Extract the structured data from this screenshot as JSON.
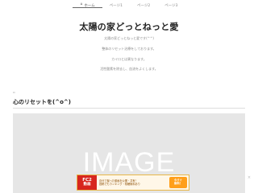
{
  "nav": {
    "items": [
      {
        "label": "ホーム",
        "icon": "home-icon",
        "active": true
      },
      {
        "label": "ページ1",
        "icon": "",
        "active": false
      },
      {
        "label": "ページ2",
        "icon": "",
        "active": false
      },
      {
        "label": "ページ3",
        "icon": "",
        "active": false
      }
    ]
  },
  "header": {
    "title": "太陽の家どっとねっと愛",
    "taglines": [
      "太陽の家どっとねっと愛です(^^)",
      "整体のリセット治療をしております。",
      "カイロとは異なります。",
      "活性酸素を除去し、血流をよくします。"
    ]
  },
  "section": {
    "icon": "document-icon",
    "heading": "心のリセットを(^o^)",
    "image_label": "IMAGE"
  },
  "ad": {
    "logo_top": "FC2",
    "logo_bottom": "動画",
    "line1": "自分で撮った動画を公開・共有！",
    "line2": "投稿でもランキング・視聴無料あり",
    "cta_line1": "今すぐ",
    "cta_line2": "無料！",
    "close": "×"
  },
  "colors": {
    "accent": "#d7261e",
    "cta": "#ff9f1a",
    "placeholder": "#e6e6e6"
  }
}
